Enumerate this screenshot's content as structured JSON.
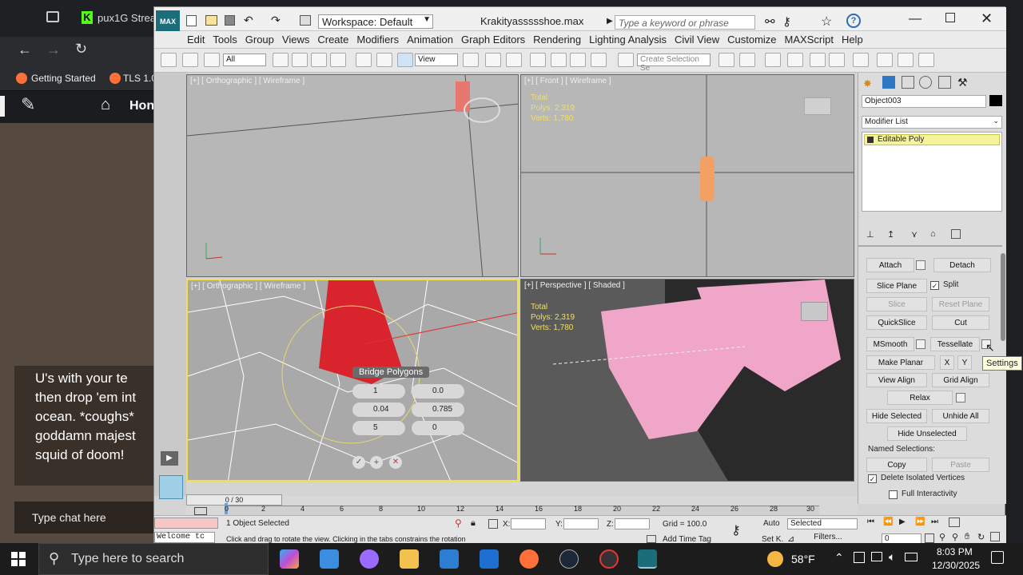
{
  "browser": {
    "tab_title": "pux1G Strea",
    "bookmarks": [
      "Getting Started",
      "TLS 1.0"
    ],
    "site_home": "Hon",
    "chat_lines": [
      "U's with your te",
      "then drop 'em int",
      "ocean. *coughs*",
      "goddamn majest",
      "squid of doom!"
    ],
    "chat_placeholder": "Type chat here"
  },
  "max": {
    "workspace": "Workspace: Default",
    "file_title": "Krakityassssshoe.max",
    "search_placeholder": "Type a keyword or phrase",
    "menus": [
      "Edit",
      "Tools",
      "Group",
      "Views",
      "Create",
      "Modifiers",
      "Animation",
      "Graph Editors",
      "Rendering",
      "Lighting Analysis",
      "Civil View",
      "Customize",
      "MAXScript",
      "Help"
    ],
    "selection_filter": "All",
    "view_mode": "View",
    "create_selection_set": "Create Selection Se",
    "viewports": {
      "top_left": "[+] [ Orthographic ] [ Wireframe ]",
      "top_right": "[+] [ Front ] [ Wireframe ]",
      "bottom_left": "[+] [ Orthographic ] [ Wireframe ]",
      "bottom_right": "[+] [ Perspective ] [ Shaded ]"
    },
    "stats": {
      "total": "Total",
      "polys": "Polys:  2,319",
      "verts": "Verts:  1,780"
    },
    "bridge": {
      "title": "Bridge Polygons",
      "segments": "1",
      "taper": "0.0",
      "bias": "0.04",
      "smooth": "0.785",
      "twist1": "5",
      "twist2": "0"
    },
    "panel": {
      "object_name": "Object003",
      "modifier_list": "Modifier List",
      "stack_item": "Editable Poly",
      "attach": "Attach",
      "detach": "Detach",
      "slice_plane": "Slice Plane",
      "split": "Split",
      "slice": "Slice",
      "reset_plane": "Reset Plane",
      "quickslice": "QuickSlice",
      "cut": "Cut",
      "msmooth": "MSmooth",
      "tessellate": "Tessellate",
      "make_planar": "Make Planar",
      "x": "X",
      "y": "Y",
      "view_align": "View Align",
      "grid_align": "Grid Align",
      "relax": "Relax",
      "hide_selected": "Hide Selected",
      "unhide_all": "Unhide All",
      "hide_unselected": "Hide Unselected",
      "named_selections": "Named Selections:",
      "copy": "Copy",
      "paste": "Paste",
      "delete_isolated": "Delete Isolated Vertices",
      "full_interactivity": "Full Interactivity",
      "tooltip": "Settings"
    },
    "timeline": {
      "frame": "0 / 30",
      "ticks": [
        "0",
        "2",
        "4",
        "6",
        "8",
        "10",
        "12",
        "14",
        "16",
        "18",
        "20",
        "22",
        "24",
        "26",
        "28",
        "30"
      ]
    },
    "status": {
      "welcome": "Welcome tc",
      "selected": "1 Object Selected",
      "hint": "Click and drag to rotate the view.  Clicking in the tabs constrains the rotation",
      "x_label": "X:",
      "y_label": "Y:",
      "z_label": "Z:",
      "grid": "Grid = 100.0",
      "add_time_tag": "Add Time Tag",
      "auto": "Auto",
      "set_k": "Set K.",
      "selected_dd": "Selected",
      "filters": "Filters...",
      "frame_field": "0"
    }
  },
  "taskbar": {
    "search": "Type here to search",
    "weather": "58°F",
    "time": "8:03 PM",
    "date": "12/30/2025"
  }
}
